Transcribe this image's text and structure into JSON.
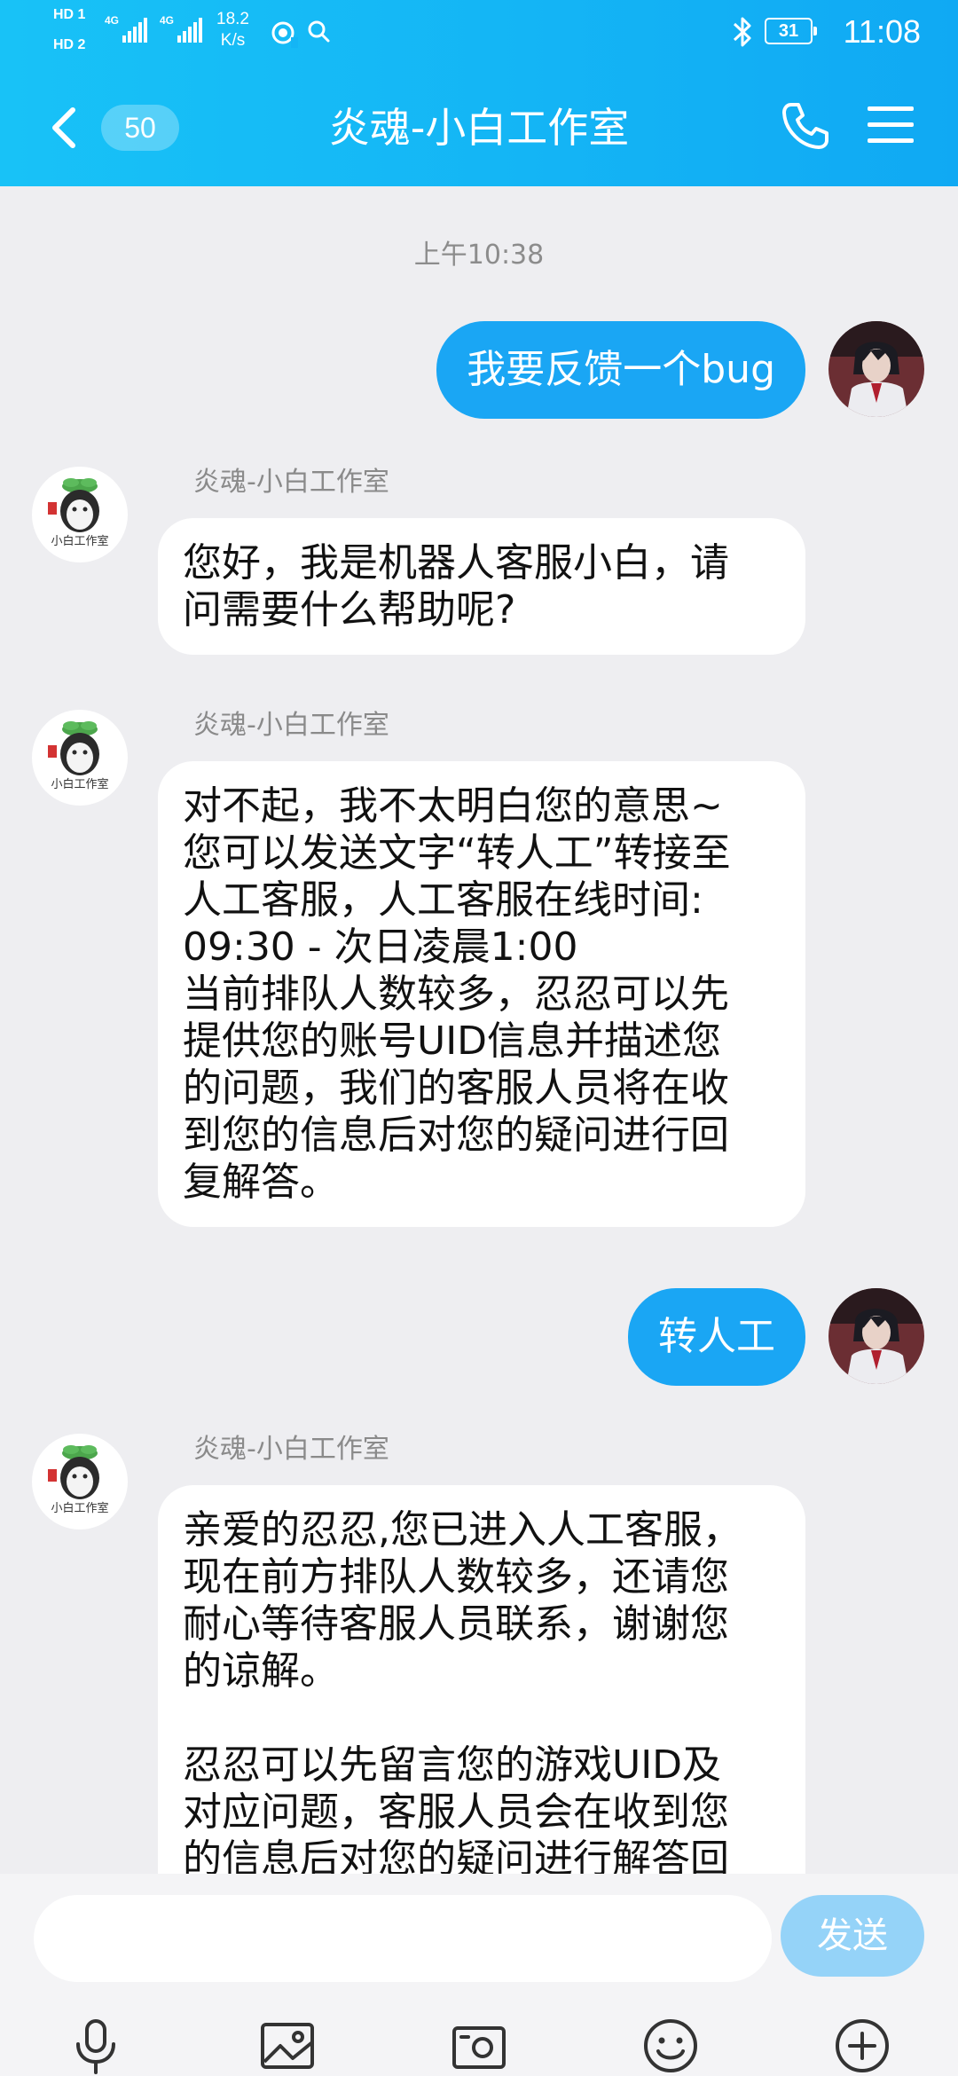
{
  "status_bar": {
    "sim1": "HD 1",
    "sim2": "HD 2",
    "net1": "4G",
    "net2": "4G",
    "speed_value": "18.2",
    "speed_unit": "K/s",
    "battery": "31",
    "time": "11:08",
    "icons": [
      "hotspot-icon",
      "search-icon",
      "bluetooth-icon",
      "battery-icon"
    ]
  },
  "header": {
    "unread_count": "50",
    "title": "炎魂-小白工作室",
    "icons": [
      "back-icon",
      "phone-icon",
      "menu-icon"
    ]
  },
  "chat": {
    "timestamp": "上午10:38",
    "messages": [
      {
        "direction": "out",
        "text": "我要反馈一个bug"
      },
      {
        "direction": "in",
        "sender": "炎魂-小白工作室",
        "text": "您好，我是机器人客服小白，请\n问需要什么帮助呢?"
      },
      {
        "direction": "in",
        "sender": "炎魂-小白工作室",
        "text": "对不起，我不太明白您的意思~\n您可以发送文字“转人工”转接至\n人工客服，人工客服在线时间:\n09:30 - 次日凌晨1:00\n当前排队人数较多，忍忍可以先\n提供您的账号UID信息并描述您\n的问题，我们的客服人员将在收\n到您的信息后对您的疑问进行回\n复解答。"
      },
      {
        "direction": "out",
        "text": "转人工"
      },
      {
        "direction": "in",
        "sender": "炎魂-小白工作室",
        "text": "亲爱的忍忍,您已进入人工客服，\n现在前方排队人数较多，还请您\n耐心等待客服人员联系，谢谢您\n的谅解。\n\n忍忍可以先留言您的游戏UID及\n对应问题，客服人员会在收到您\n的信息后对您的疑问进行解答回"
      }
    ],
    "avatar_text": "小白工作室"
  },
  "input": {
    "value": "",
    "send_label": "发送"
  },
  "toolbar": {
    "icons": [
      "microphone-icon",
      "image-icon",
      "camera-icon",
      "emoji-icon",
      "plus-icon"
    ]
  },
  "colors": {
    "header": "#14B5F5",
    "outgoing_bubble": "#1AA6F4",
    "send_button": "#95D3F8",
    "background": "#EEEEF1"
  }
}
